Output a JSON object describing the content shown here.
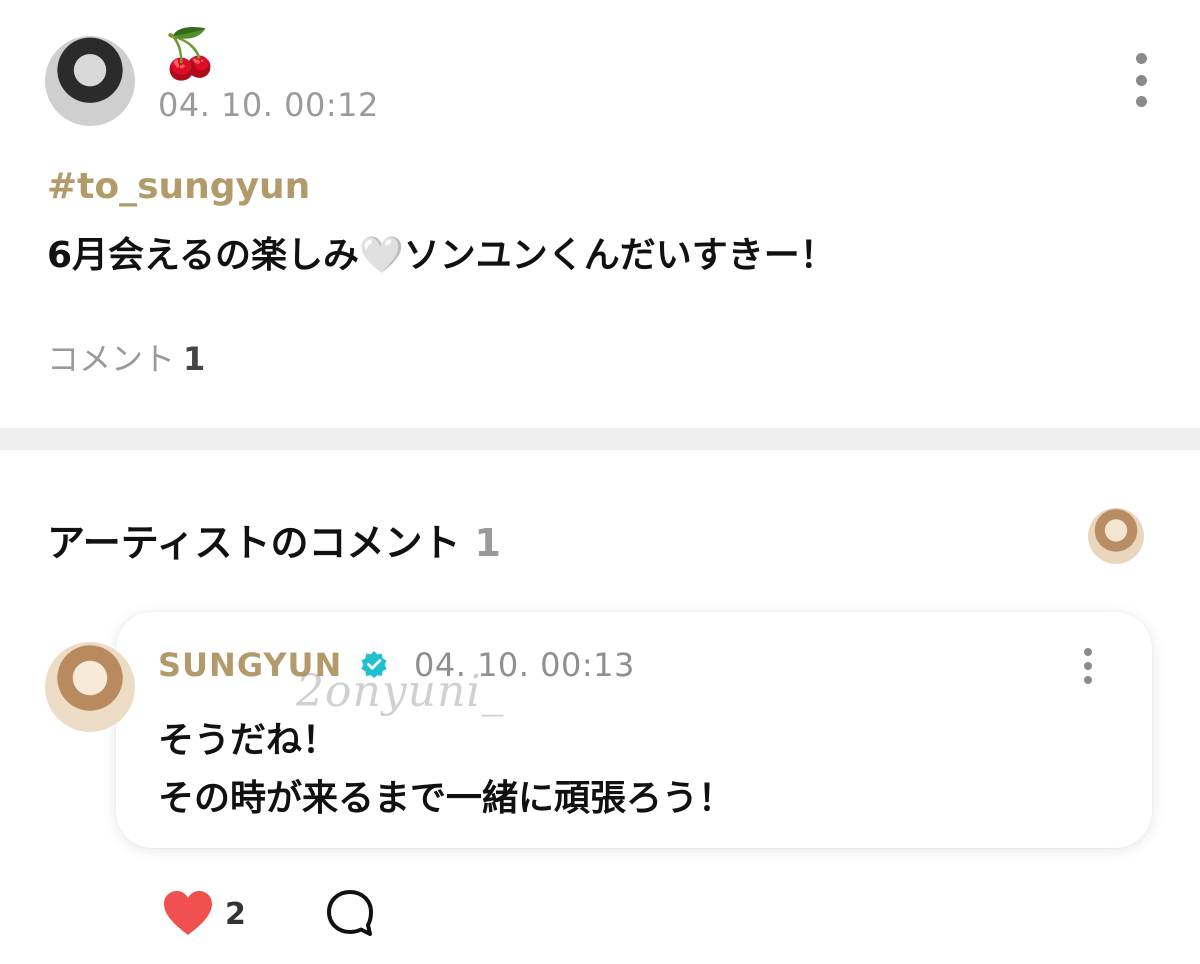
{
  "post": {
    "author_emoji": "🍒",
    "timestamp": "04. 10. 00:12",
    "hashtag": "#to_sungyun",
    "body": "6月会えるの楽しみ🤍ソンユンくんだいすきー！",
    "comments_label": "コメント",
    "comments_count": "1"
  },
  "artist_section": {
    "heading": "アーティストのコメント",
    "count": "1"
  },
  "artist_comment": {
    "name": "SUNGYUN",
    "timestamp": "04. 10. 00:13",
    "lines": [
      "そうだね！",
      "その時が来るまで一緒に頑張ろう！"
    ],
    "watermark": "2onyuni_"
  },
  "actions": {
    "like_count": "2"
  },
  "colors": {
    "accent_gold": "#b39a6b",
    "verified_teal": "#1fc1d0",
    "heart_red": "#f0504f",
    "muted_gray": "#9a9a9a",
    "divider_gray": "#efefef"
  },
  "icons": {
    "verified": "verified-badge-icon",
    "more": "more-vertical-icon",
    "like": "heart-icon",
    "reply": "speech-bubble-icon"
  }
}
